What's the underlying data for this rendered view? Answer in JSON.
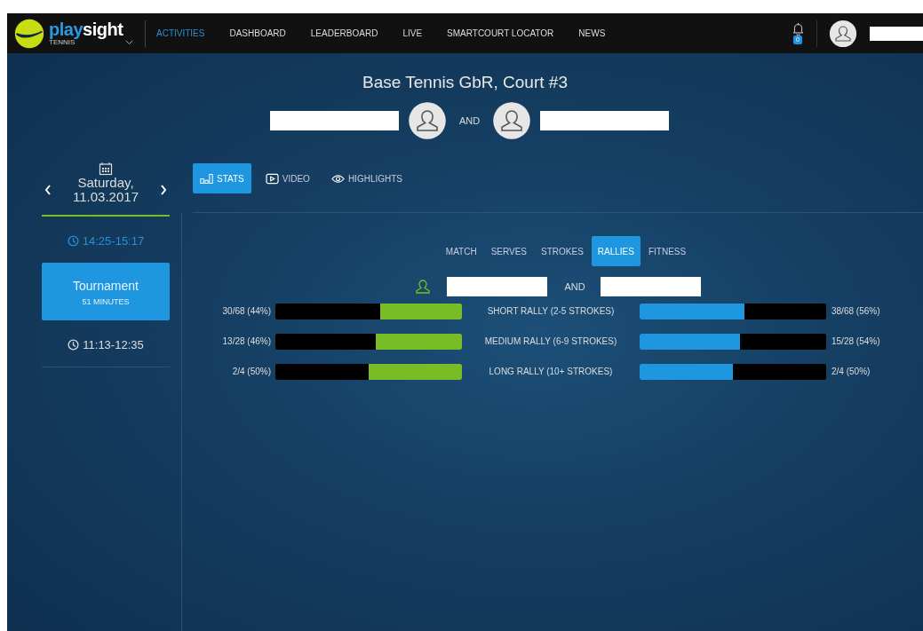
{
  "header": {
    "brand": [
      "play",
      "sight"
    ],
    "sport": "TENNIS",
    "nav": [
      {
        "label": "ACTIVITIES",
        "selected": true
      },
      {
        "label": "DASHBOARD",
        "selected": false
      },
      {
        "label": "LEADERBOARD",
        "selected": false
      },
      {
        "label": "LIVE",
        "selected": false
      },
      {
        "label": "SMARTCOURT LOCATOR",
        "selected": false
      },
      {
        "label": "NEWS",
        "selected": false
      }
    ],
    "notification_count": "0"
  },
  "title": "Base Tennis GbR, Court #3",
  "players_joiner": "AND",
  "date": {
    "weekday": "Saturday,",
    "day": "11.03.2017"
  },
  "sessions": [
    {
      "time": "14:25-15:17",
      "expanded": true,
      "activities": [
        {
          "title": "Tournament",
          "duration": "51 MINUTES",
          "selected": true
        }
      ]
    },
    {
      "time": "11:13-12:35",
      "expanded": false
    }
  ],
  "view_tabs": [
    {
      "label": "STATS",
      "kind": "chart",
      "selected": true
    },
    {
      "label": "VIDEO",
      "kind": "video",
      "selected": false
    },
    {
      "label": "HIGHLIGHTS",
      "kind": "eye",
      "selected": false
    }
  ],
  "stat_tabs": [
    {
      "label": "MATCH",
      "selected": false
    },
    {
      "label": "SERVES",
      "selected": false
    },
    {
      "label": "STROKES",
      "selected": false
    },
    {
      "label": "RALLIES",
      "selected": true
    },
    {
      "label": "FITNESS",
      "selected": false
    }
  ],
  "comparison": {
    "joiner": "AND",
    "rows": [
      {
        "label": "SHORT RALLY (2-5 STROKES)",
        "left": {
          "reading": "30/68 (44%)",
          "level": 0.44
        },
        "right": {
          "reading": "38/68 (56%)",
          "level": 0.56
        }
      },
      {
        "label": "MEDIUM RALLY (6-9 STROKES)",
        "left": {
          "reading": "13/28 (46%)",
          "level": 0.46
        },
        "right": {
          "reading": "15/28 (54%)",
          "level": 0.54
        }
      },
      {
        "label": "LONG RALLY (10+ STROKES)",
        "left": {
          "reading": "2/4 (50%)",
          "level": 0.5
        },
        "right": {
          "reading": "2/4 (50%)",
          "level": 0.5
        }
      }
    ]
  }
}
